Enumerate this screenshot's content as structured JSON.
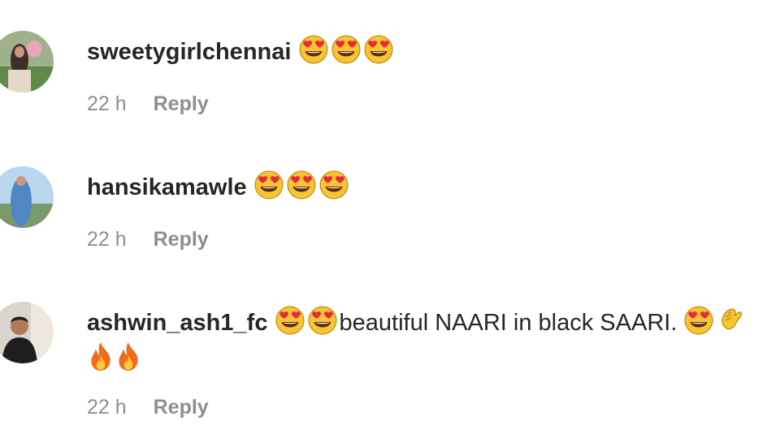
{
  "comments": [
    {
      "username": "sweetygirlchennai",
      "emojis_after_name": [
        "heart-eyes",
        "heart-eyes",
        "heart-eyes"
      ],
      "text": "",
      "time": "22 h",
      "reply_label": "Reply"
    },
    {
      "username": "hansikamawle",
      "emojis_after_name": [
        "heart-eyes",
        "heart-eyes",
        "heart-eyes"
      ],
      "text": "",
      "time": "22 h",
      "reply_label": "Reply"
    },
    {
      "username": "ashwin_ash1_fc",
      "emojis_after_name": [
        "heart-eyes",
        "heart-eyes"
      ],
      "text": "beautiful NAARI in black SAARI.",
      "emojis_after_text": [
        "heart-eyes",
        "clapping-hands"
      ],
      "emojis_second_line": [
        "fire",
        "fire"
      ],
      "time": "22 h",
      "reply_label": "Reply"
    }
  ],
  "colors": {
    "username": "#262626",
    "meta": "#8e8e8e",
    "emoji_face": "#F7C531",
    "emoji_heart": "#E8283C",
    "fire_outer": "#F26B1D",
    "fire_inner": "#FFC83D"
  }
}
